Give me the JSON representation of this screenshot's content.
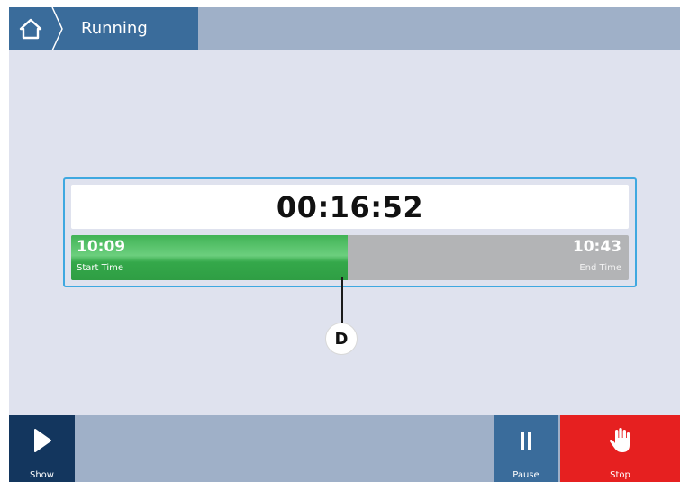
{
  "header": {
    "title": "Running",
    "home_icon": "home-icon"
  },
  "timer": {
    "elapsed": "00:16:52"
  },
  "progress": {
    "start_time": "10:09",
    "start_label": "Start Time",
    "end_time": "10:43",
    "end_label": "End Time",
    "fraction": 0.496
  },
  "callout": {
    "label": "D"
  },
  "footer": {
    "show_label": "Show",
    "pause_label": "Pause",
    "stop_label": "Stop"
  },
  "colors": {
    "header_accent": "#3a6c9b",
    "bar_fill": "#41b356",
    "bar_track": "#b3b4b6",
    "panel_border": "#3fa8e0",
    "stop": "#e62020",
    "show": "#13365e"
  }
}
